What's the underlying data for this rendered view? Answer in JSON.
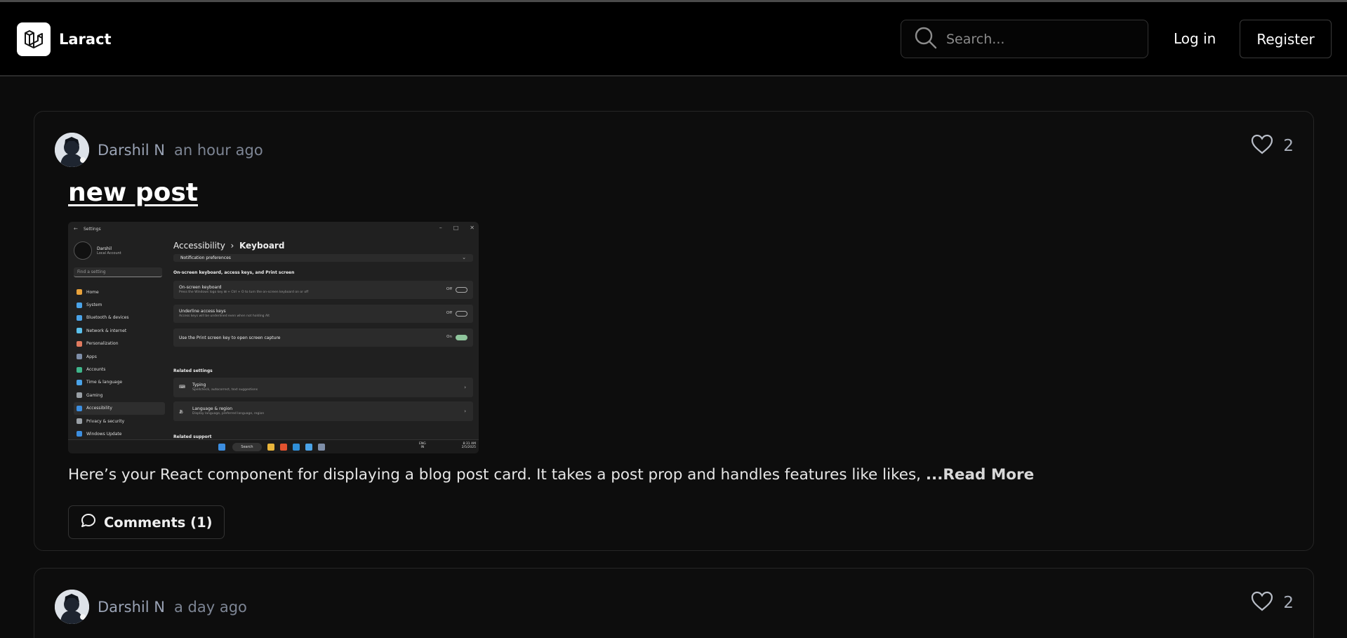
{
  "header": {
    "brand": "Laract",
    "search_placeholder": "Search...",
    "login": "Log in",
    "register": "Register"
  },
  "posts": [
    {
      "author": "Darshil N",
      "time": "an hour ago",
      "likes": "2",
      "title": "new post",
      "excerpt": "Here’s your React component for displaying a blog post card. It takes a post prop and handles features like likes, ",
      "read_more": "...Read More",
      "comments": "Comments (1)"
    },
    {
      "author": "Darshil N",
      "time": "a day ago",
      "likes": "2"
    }
  ],
  "screenshot": {
    "app": "Settings",
    "user_name": "Darshil",
    "user_sub": "Local Account",
    "find": "Find a setting",
    "nav": [
      {
        "label": "Home",
        "color": "#e9a23b"
      },
      {
        "label": "System",
        "color": "#4aa3e8"
      },
      {
        "label": "Bluetooth & devices",
        "color": "#4aa3e8"
      },
      {
        "label": "Network & internet",
        "color": "#5bc0eb"
      },
      {
        "label": "Personalization",
        "color": "#e07a5f"
      },
      {
        "label": "Apps",
        "color": "#7e8ea8"
      },
      {
        "label": "Accounts",
        "color": "#3fb68b"
      },
      {
        "label": "Time & language",
        "color": "#4aa3e8"
      },
      {
        "label": "Gaming",
        "color": "#9aa0a6"
      },
      {
        "label": "Accessibility",
        "color": "#3c8ee0"
      },
      {
        "label": "Privacy & security",
        "color": "#9aa0a6"
      },
      {
        "label": "Windows Update",
        "color": "#3c8ee0"
      }
    ],
    "crumb_parent": "Accessibility",
    "crumb_sep": "›",
    "crumb_current": "Keyboard",
    "notif": "Notification preferences",
    "section1": "On-screen keyboard, access keys, and Print screen",
    "osk_title": "On-screen keyboard",
    "osk_desc": "Press the Windows logo key ⊞ + Ctrl + O to turn the on-screen keyboard on or off",
    "osk_state": "Off",
    "ual_title": "Underline access keys",
    "ual_desc": "Access keys will be underlined even when not holding Alt",
    "ual_state": "Off",
    "prt_title": "Use the Print screen key to open screen capture",
    "prt_state": "On",
    "related": "Related settings",
    "typing_title": "Typing",
    "typing_desc": "Spellcheck, autocorrect, text suggestions",
    "lang_title": "Language & region",
    "lang_desc": "Display language, preferred language, region",
    "support": "Related support",
    "tb_search": "Search",
    "tb_lang1": "ENG",
    "tb_lang2": "IN",
    "tb_time": "8:31 AM",
    "tb_date": "2/5/2025"
  }
}
